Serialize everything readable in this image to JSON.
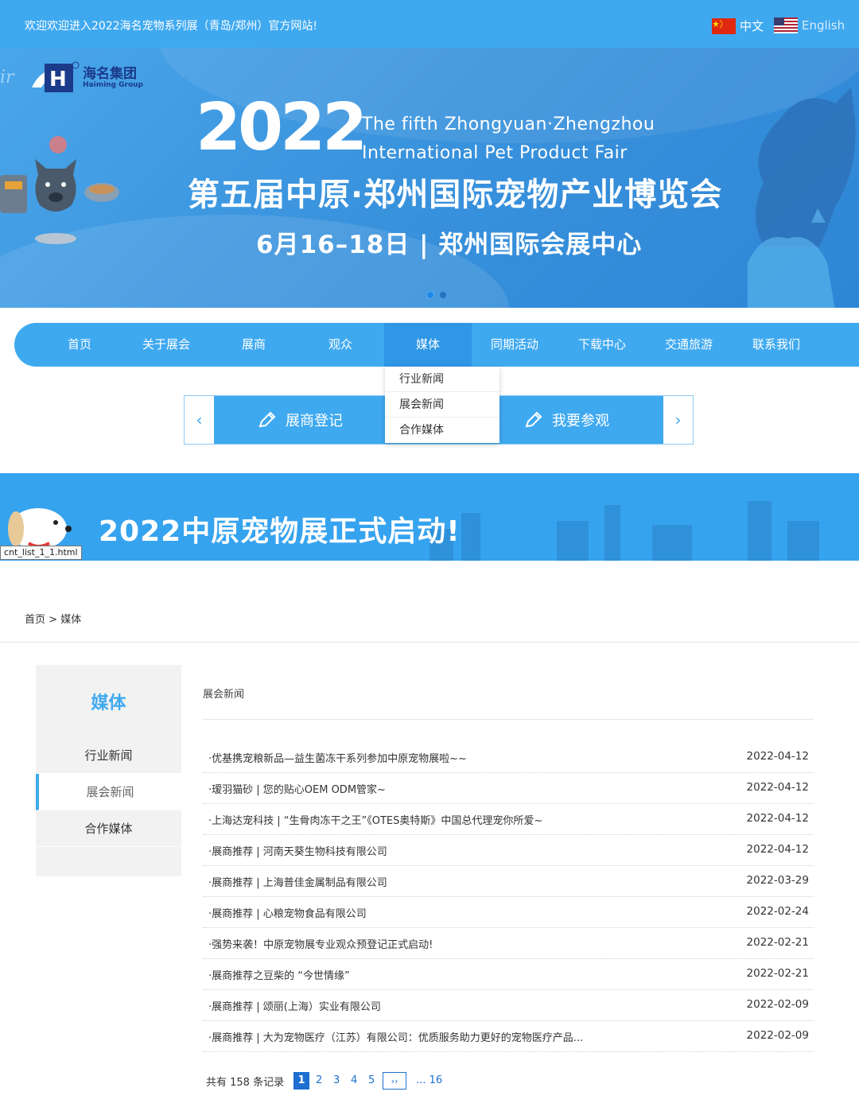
{
  "topbar": {
    "welcome": "欢迎欢迎进入2022海名宠物系列展（青岛/郑州）官方网站!",
    "lang_cn": "中文",
    "lang_en": "English"
  },
  "hero": {
    "logo_cn": "海名集团",
    "logo_en": "Haiming Group",
    "year": "2022",
    "en_line1": "The fifth Zhongyuan·Zhengzhou",
    "en_line2": "International Pet Product Fair",
    "cn_title": "第五届中原·郑州国际宠物产业博览会",
    "date_line": "6月16–18日 | 郑州国际会展中心"
  },
  "nav": {
    "items": [
      "首页",
      "关于展会",
      "展商",
      "观众",
      "媒体",
      "同期活动",
      "下载中心",
      "交通旅游",
      "联系我们"
    ],
    "active_index": 4
  },
  "dropdown": {
    "items": [
      "行业新闻",
      "展会新闻",
      "合作媒体"
    ]
  },
  "buttons": {
    "prev": "‹",
    "next": "›",
    "exhibitor": "展商登记",
    "visitor": "我要参观"
  },
  "subbanner": {
    "title": "2022中原宠物展正式启动!"
  },
  "tooltip": "cnt_list_1_1.html",
  "breadcrumb": {
    "home": "首页",
    "sep": " > ",
    "current": "媒体"
  },
  "sidebar": {
    "title": "媒体",
    "items": [
      "行业新闻",
      "展会新闻",
      "合作媒体"
    ],
    "active_index": 1
  },
  "list": {
    "heading": "展会新闻",
    "rows": [
      {
        "title": "·优基携宠粮新品—益生菌冻干系列参加中原宠物展啦~~",
        "date": "2022-04-12"
      },
      {
        "title": "·瑷羽猫砂 | 您的贴心OEM ODM管家~",
        "date": "2022-04-12"
      },
      {
        "title": "·上海达宠科技 |  “生骨肉冻干之王”《OTES奥特斯》中国总代理宠你所爱~",
        "date": "2022-04-12"
      },
      {
        "title": "·展商推荐 | 河南天葵生物科技有限公司",
        "date": "2022-04-12"
      },
      {
        "title": "·展商推荐 | 上海普佳金属制品有限公司",
        "date": "2022-03-29"
      },
      {
        "title": "·展商推荐 | 心粮宠物食品有限公司",
        "date": "2022-02-24"
      },
      {
        "title": "·强势来袭！中原宠物展专业观众预登记正式启动!",
        "date": "2022-02-21"
      },
      {
        "title": "·展商推荐之豆柴的 “今世情缘”",
        "date": "2022-02-21"
      },
      {
        "title": "·展商推荐 | 颂丽(上海）实业有限公司",
        "date": "2022-02-09"
      },
      {
        "title": "·展商推荐 | 大为宠物医疗（江苏）有限公司：优质服务助力更好的宠物医疗产品...",
        "date": "2022-02-09"
      }
    ]
  },
  "pager": {
    "total": "共有 158 条记录",
    "pages": [
      "1",
      "2",
      "3",
      "4",
      "5"
    ],
    "current": "1",
    "next": "››",
    "last": "... 16"
  },
  "colors": {
    "primary": "#3fa9f0",
    "nav_active": "#2f97e6",
    "link": "#1e6fd1"
  }
}
